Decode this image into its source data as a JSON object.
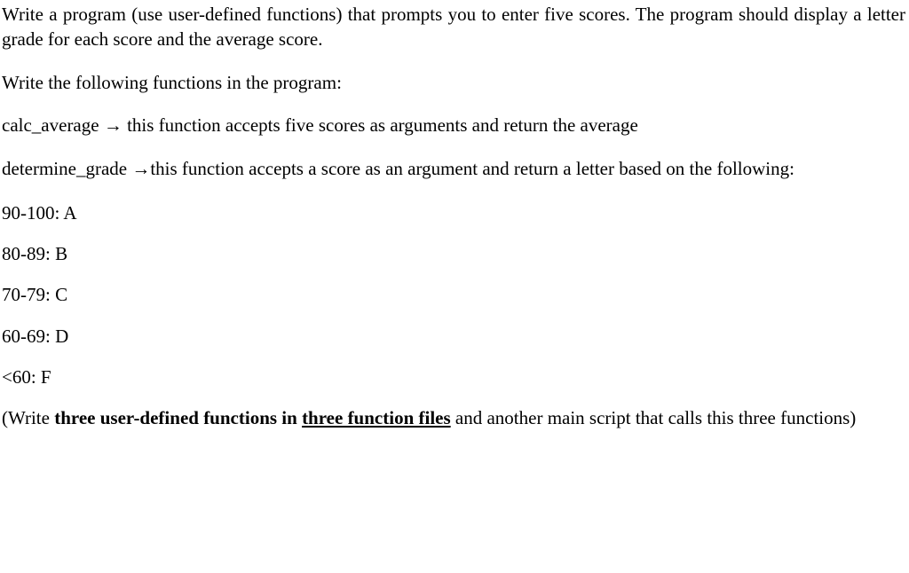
{
  "p1a": "Write a program (use user-defined functions) that prompts you to enter five scores. The program should display a letter grade for each score and the average score.",
  "p2": "Write the following functions in the program:",
  "p3_name": "calc_average ",
  "arrow": "→",
  "p3_rest": " this function accepts five scores as arguments and return the average",
  "p4_name": "determine_grade ",
  "p4_rest": "this function accepts a score as an argument and return a letter based on the following:",
  "grades": [
    "90-100: A",
    "80-89: B",
    "70-79: C",
    "60-69: D",
    "<60: F"
  ],
  "p5_open": "(Write ",
  "p5_b1": "three user-defined functions in ",
  "p5_u": "three function files",
  "p5_rest": " and another main script that calls this three functions)"
}
